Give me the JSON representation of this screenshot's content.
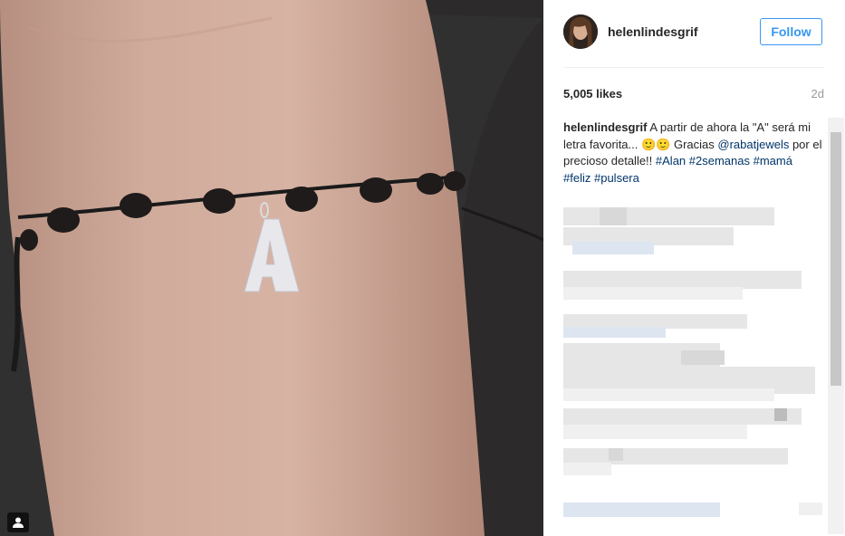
{
  "post": {
    "username": "helenlindesgrif",
    "follow_label": "Follow",
    "likes": "5,005 likes",
    "time": "2d"
  },
  "caption": {
    "author": "helenlindesgrif",
    "text_1": " A partir de ahora la \"A\" será mi letra favorita... 🙂🙂 Gracias ",
    "mention": "@rabatjewels",
    "text_2": " por el precioso detalle!! ",
    "tags": [
      "#Alan",
      "#2semanas",
      "#mamá",
      "#feliz",
      "#pulsera"
    ]
  },
  "icons": {
    "user_tag": "person-icon"
  },
  "colors": {
    "accent": "#3897f0",
    "link": "#003569"
  }
}
